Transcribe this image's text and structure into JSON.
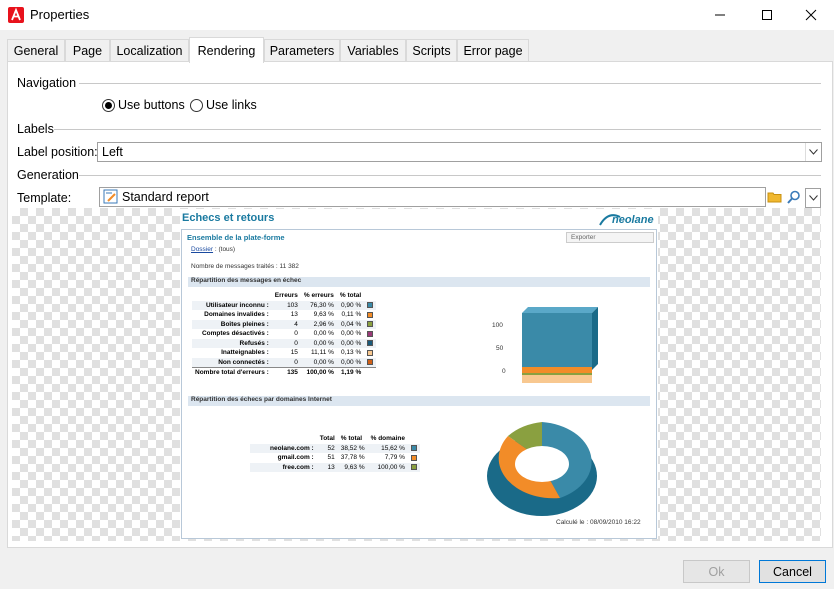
{
  "window": {
    "title": "Properties",
    "minimize_icon": "minimize-icon",
    "maximize_icon": "maximize-icon",
    "close_icon": "close-icon"
  },
  "tabs": [
    {
      "label": "General"
    },
    {
      "label": "Page"
    },
    {
      "label": "Localization"
    },
    {
      "label": "Rendering"
    },
    {
      "label": "Parameters"
    },
    {
      "label": "Variables"
    },
    {
      "label": "Scripts"
    },
    {
      "label": "Error page"
    }
  ],
  "active_tab": "Rendering",
  "navigation": {
    "heading": "Navigation",
    "opt_buttons": "Use buttons",
    "opt_links": "Use links",
    "selected": "Use buttons"
  },
  "labels": {
    "heading": "Labels",
    "position_label": "Label position:",
    "position_value": "Left"
  },
  "generation": {
    "heading": "Generation",
    "template_label": "Template:",
    "template_value": "Standard report"
  },
  "report": {
    "title": "Echecs et retours",
    "logo": "neolane",
    "subtitle": "Ensemble de la plate-forme",
    "export_label": "Exporter",
    "folder_label": "Dossier",
    "folder_value": ": (tous)",
    "processed_label": "Nombre de messages traités :",
    "processed_value": "11 382",
    "section1": "Répartition des messages en échec",
    "table1_headers": [
      "Erreurs",
      "% erreurs",
      "% total"
    ],
    "table1_rows": [
      {
        "label": "Utilisateur inconnu :",
        "n": "103",
        "pe": "76,30 %",
        "pt": "0,90 %",
        "color": "#3a8aa8"
      },
      {
        "label": "Domaines invalides :",
        "n": "13",
        "pe": "9,63 %",
        "pt": "0,11 %",
        "color": "#f28c28"
      },
      {
        "label": "Boîtes pleines :",
        "n": "4",
        "pe": "2,96 %",
        "pt": "0,04 %",
        "color": "#8aa040"
      },
      {
        "label": "Comptes désactivés :",
        "n": "0",
        "pe": "0,00 %",
        "pt": "0,00 %",
        "color": "#9a3a78"
      },
      {
        "label": "Refusés :",
        "n": "0",
        "pe": "0,00 %",
        "pt": "0,00 %",
        "color": "#1a5a7a"
      },
      {
        "label": "Inatteignables :",
        "n": "15",
        "pe": "11,11 %",
        "pt": "0,13 %",
        "color": "#f8c890"
      },
      {
        "label": "Non connectés :",
        "n": "0",
        "pe": "0,00 %",
        "pt": "0,00 %",
        "color": "#d06018"
      }
    ],
    "table1_total": {
      "label": "Nombre total d'erreurs :",
      "n": "135",
      "pe": "100,00 %",
      "pt": "1,19 %"
    },
    "chart1_ticks": [
      "100",
      "50",
      "0"
    ],
    "section2": "Répartition des échecs par domaines Internet",
    "table2_headers": [
      "Total",
      "% total",
      "% domaine"
    ],
    "table2_rows": [
      {
        "label": "neolane.com :",
        "n": "52",
        "pt": "38,52 %",
        "pd": "15,62 %",
        "color": "#3a8aa8"
      },
      {
        "label": "gmail.com :",
        "n": "51",
        "pt": "37,78 %",
        "pd": "7,79 %",
        "color": "#f28c28"
      },
      {
        "label": "free.com :",
        "n": "13",
        "pt": "9,63 %",
        "pd": "100,00 %",
        "color": "#8aa040"
      }
    ],
    "calc_label": "Calculé le : 08/09/2010 16:22"
  },
  "buttons": {
    "ok": "Ok",
    "cancel": "Cancel"
  },
  "colors": {
    "accent": "#0078d7",
    "report_title": "#1a7aa0",
    "section_bg": "#dce6f0"
  }
}
